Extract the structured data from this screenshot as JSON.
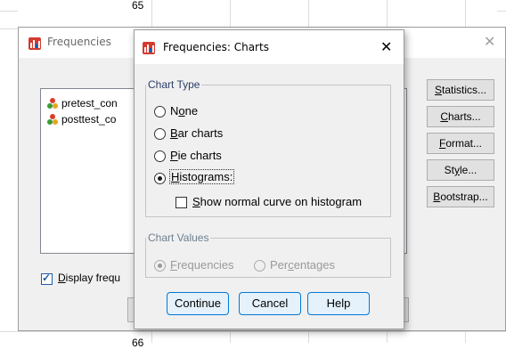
{
  "background": {
    "cell_top": "65",
    "cell_bottom": "66"
  },
  "parent_dialog": {
    "title": "Frequencies",
    "close_glyph": "✕",
    "variables": [
      "pretest_con",
      "posttest_co"
    ],
    "display_check_label_pre": "D",
    "display_check_label_post": "isplay frequ",
    "buttons": {
      "statistics": {
        "pre": "",
        "u": "S",
        "post": "tatistics..."
      },
      "charts": {
        "pre": "",
        "u": "C",
        "post": "harts..."
      },
      "format": {
        "pre": "",
        "u": "F",
        "post": "ormat..."
      },
      "style": {
        "pre": "St",
        "u": "y",
        "post": "le..."
      },
      "bootstrap": {
        "pre": "",
        "u": "B",
        "post": "ootstrap..."
      }
    }
  },
  "dialog": {
    "title": "Frequencies: Charts",
    "close_glyph": "✕",
    "chart_type_legend": "Chart Type",
    "options": {
      "none": {
        "pre": "N",
        "u": "o",
        "post": "ne"
      },
      "bar": {
        "pre": "",
        "u": "B",
        "post": "ar charts"
      },
      "pie": {
        "pre": "",
        "u": "P",
        "post": "ie charts"
      },
      "hist": {
        "pre": "",
        "u": "H",
        "post": "istograms:"
      }
    },
    "selected_chart_type": "histograms",
    "normal_curve": {
      "pre": "",
      "u": "S",
      "post": "how normal curve on histogram",
      "checked": false
    },
    "chart_values_legend": "Chart Values",
    "values": {
      "freq": {
        "pre": "",
        "u": "F",
        "post": "requencies"
      },
      "pct": {
        "pre": "Per",
        "u": "c",
        "post": "entages"
      }
    },
    "selected_chart_value": "frequencies",
    "buttons": {
      "continue": "Continue",
      "cancel": "Cancel",
      "help": "Help"
    }
  },
  "colors": {
    "accent": "#0078d7",
    "dialog_bg": "#f0f0f0",
    "legend": "#2c3e68"
  }
}
